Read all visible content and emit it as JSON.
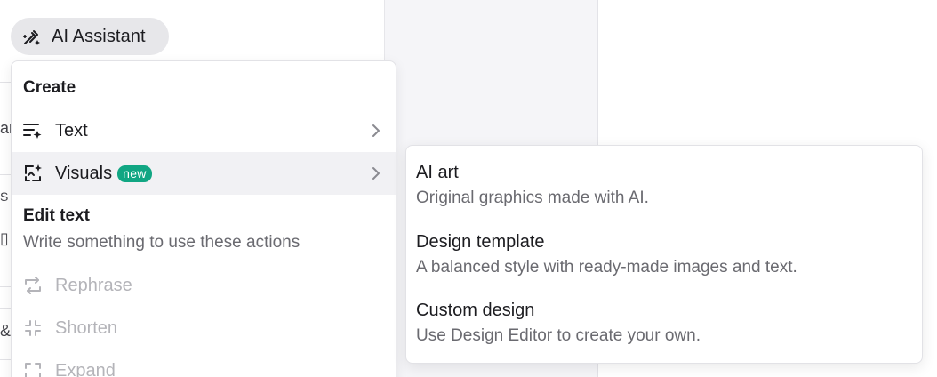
{
  "assistant_button": {
    "label": "AI Assistant",
    "icon": "magic-pen-icon"
  },
  "menu": {
    "create_section": {
      "title": "Create",
      "items": [
        {
          "label": "Text",
          "icon": "text-sparkle-icon",
          "has_submenu": true
        },
        {
          "label": "Visuals",
          "icon": "visual-sparkle-icon",
          "badge": "new",
          "has_submenu": true,
          "active": true
        }
      ]
    },
    "edit_section": {
      "title": "Edit text",
      "description": "Write something to use these actions",
      "items": [
        {
          "label": "Rephrase",
          "icon": "rephrase-icon",
          "disabled": true
        },
        {
          "label": "Shorten",
          "icon": "shorten-icon",
          "disabled": true
        },
        {
          "label": "Expand",
          "icon": "expand-icon",
          "disabled": true
        }
      ]
    }
  },
  "submenu": {
    "options": [
      {
        "title": "AI art",
        "description": "Original graphics made with AI."
      },
      {
        "title": "Design template",
        "description": "A balanced style with ready-made images and text."
      },
      {
        "title": "Custom design",
        "description": "Use Design Editor to create your own."
      }
    ]
  },
  "colors": {
    "badge_bg": "#11a683",
    "pill_bg": "#e7e7ea",
    "disabled_text": "#b4b4b9",
    "muted_text": "#6a6a70"
  }
}
